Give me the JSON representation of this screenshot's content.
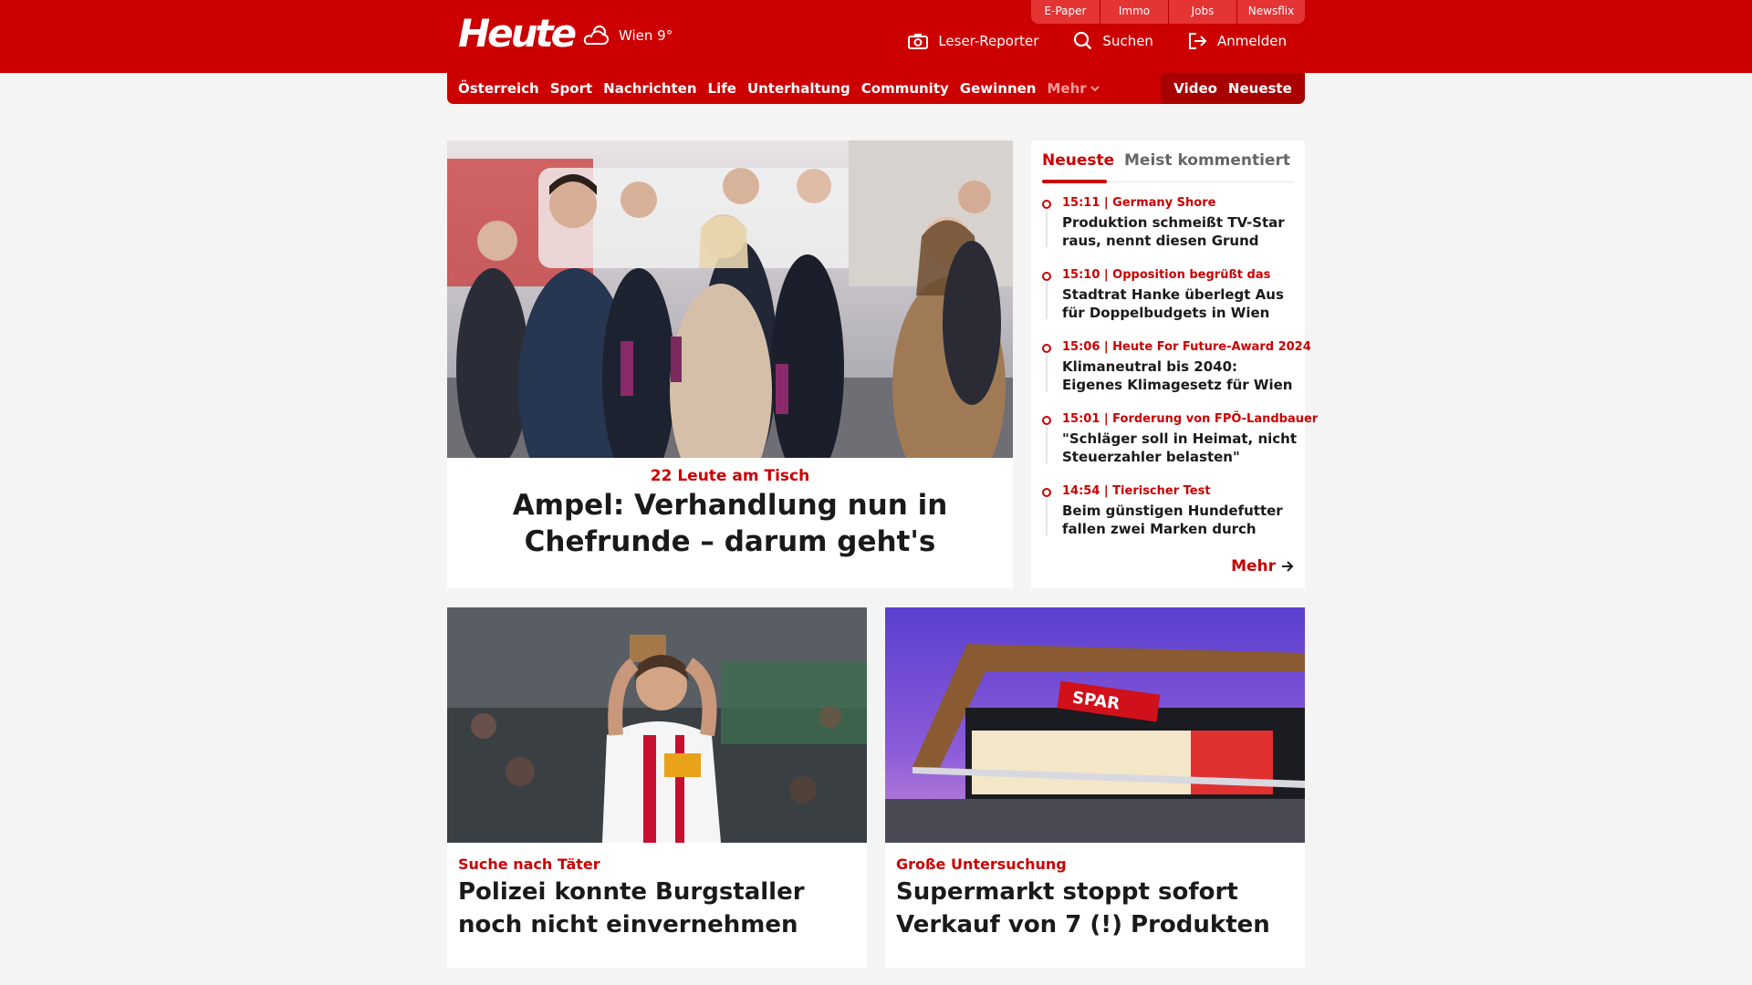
{
  "header": {
    "logo_text": "Heute",
    "weather": {
      "icon": "cloud-sun-icon",
      "label": "Wien 9°"
    },
    "service_tabs": [
      "E-Paper",
      "Immo",
      "Jobs",
      "Newsflix"
    ],
    "actions": [
      {
        "icon": "camera-icon",
        "label": "Leser-Reporter"
      },
      {
        "icon": "search-icon",
        "label": "Suchen"
      },
      {
        "icon": "login-icon",
        "label": "Anmelden"
      }
    ]
  },
  "nav": {
    "items": [
      "Österreich",
      "Sport",
      "Nachrichten",
      "Life",
      "Unterhaltung",
      "Community",
      "Gewinnen"
    ],
    "more_label": "Mehr",
    "right_items": [
      "Video",
      "Neueste"
    ]
  },
  "hero": {
    "kicker": "22 Leute am Tisch",
    "title": "Ampel: Verhandlung nun in Chefrunde – darum geht's"
  },
  "sidebar": {
    "tabs": [
      "Neueste",
      "Meist kommentiert"
    ],
    "items": [
      {
        "meta": "15:11 | Germany Shore",
        "title": "Produktion schmeißt TV-Star raus, nennt diesen Grund"
      },
      {
        "meta": "15:10 | Opposition begrüßt das",
        "title": "Stadtrat Hanke überlegt Aus für Doppelbudgets in Wien"
      },
      {
        "meta": "15:06 | Heute For Future-Award 2024",
        "title": "Klimaneutral bis 2040: Eigenes Klimagesetz für Wien"
      },
      {
        "meta": "15:01 | Forderung von FPÖ-Landbauer",
        "title": "\"Schläger soll in Heimat, nicht Steuerzahler belasten\""
      },
      {
        "meta": "14:54 | Tierischer Test",
        "title": "Beim günstigen Hundefutter fallen zwei Marken durch"
      }
    ],
    "more_label": "Mehr"
  },
  "cards": [
    {
      "kicker": "Suche nach Täter",
      "title": "Polizei konnte Burgstaller noch nicht einvernehmen"
    },
    {
      "kicker": "Große Untersuchung",
      "title": "Supermarkt stoppt sofort Verkauf von 7 (!) Produkten",
      "store_sign": "SPAR"
    }
  ],
  "colors": {
    "brand_red": "#cc0000",
    "nav_dark_red": "#a80000",
    "page_bg": "#f4f4f4"
  }
}
